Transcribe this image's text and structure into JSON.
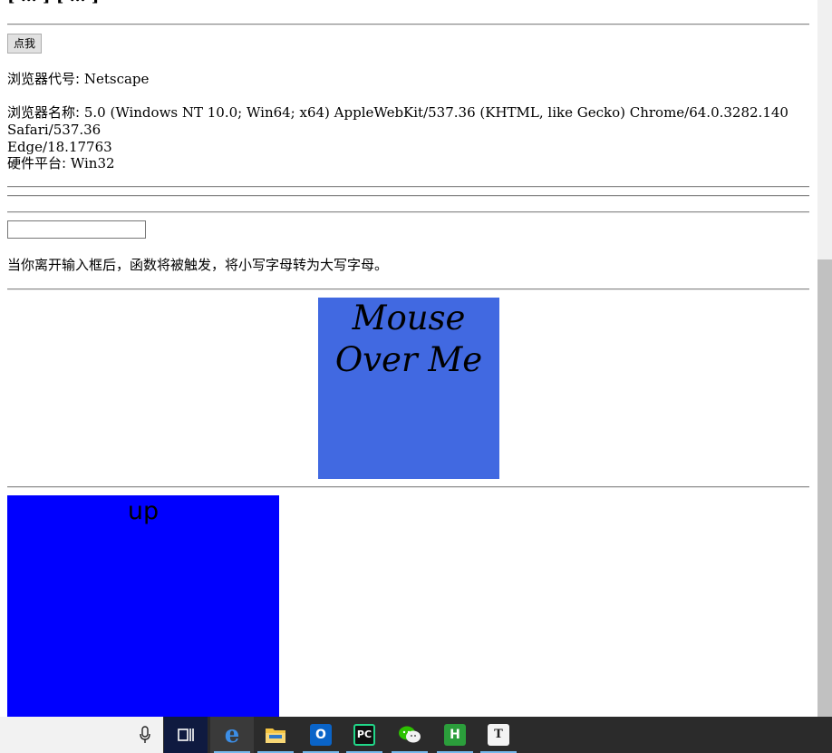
{
  "page": {
    "cut_heading": "[ … ] [ … ]",
    "button_label": "点我",
    "browser_code_label": "浏览器代号:",
    "browser_code_value": "Netscape",
    "browser_name_label": "浏览器名称:",
    "browser_name_value": "5.0 (Windows NT 10.0; Win64; x64) AppleWebKit/537.36 (KHTML, like Gecko) Chrome/64.0.3282.140 Safari/537.36",
    "browser_name_value_line2": "Edge/18.17763",
    "platform_label": "硬件平台:",
    "platform_value": "Win32",
    "text_input_value": "",
    "hint_text": "当你离开输入框后，函数将被触发，将小写字母转为大写字母。",
    "mouse_over_text": "Mouse Over Me",
    "up_box_text": "up"
  },
  "colors": {
    "mouse_box": "#4169e1",
    "up_box": "#0000ff",
    "taskbar": "#2b2b2b"
  },
  "taskbar": {
    "items": [
      {
        "name": "task-view-icon",
        "glyph": "⊟"
      },
      {
        "name": "edge-icon",
        "glyph": "e"
      },
      {
        "name": "file-explorer-icon",
        "glyph": "▬"
      },
      {
        "name": "outlook-icon",
        "glyph": "O"
      },
      {
        "name": "pycharm-icon",
        "glyph": "PC"
      },
      {
        "name": "wechat-icon",
        "glyph": "◉"
      },
      {
        "name": "hbuilder-icon",
        "glyph": "H"
      },
      {
        "name": "typora-icon",
        "glyph": "T"
      }
    ]
  }
}
